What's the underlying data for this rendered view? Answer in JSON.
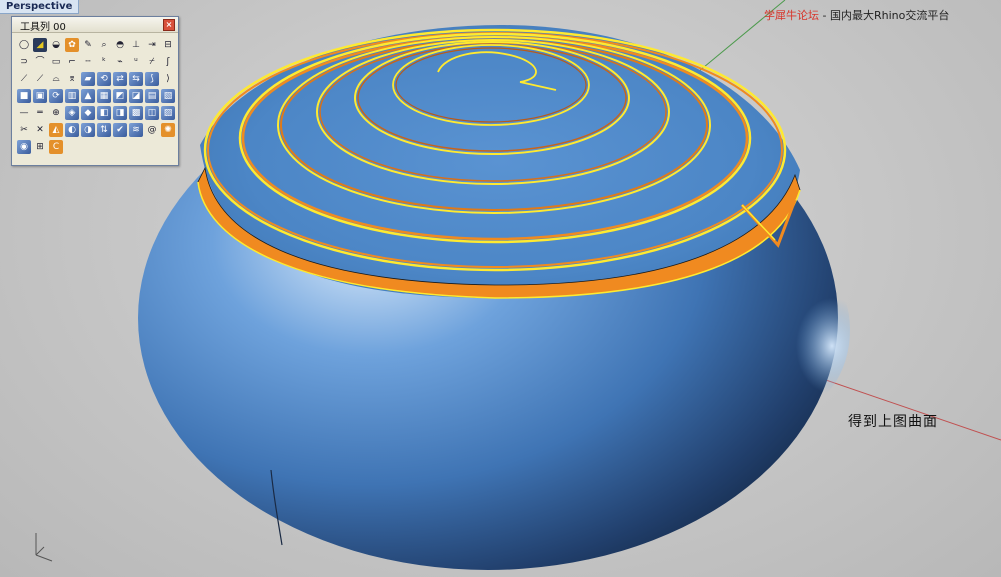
{
  "viewport": {
    "title": "Perspective"
  },
  "toolbar": {
    "title": "工具列 00",
    "close_label": "×",
    "tools": [
      {
        "name": "circle-tool",
        "glyph": "◯",
        "style": "light"
      },
      {
        "name": "shade-tool",
        "glyph": "◢",
        "style": "dark"
      },
      {
        "name": "shield-tool",
        "glyph": "◒",
        "style": "light"
      },
      {
        "name": "gear-tool",
        "glyph": "✿",
        "style": "orange"
      },
      {
        "name": "pencil-tool",
        "glyph": "✎",
        "style": "light"
      },
      {
        "name": "magnify-tool",
        "glyph": "⌕",
        "style": "light"
      },
      {
        "name": "dish-tool",
        "glyph": "◓",
        "style": "light"
      },
      {
        "name": "axis-tool",
        "glyph": "⊥",
        "style": "light"
      },
      {
        "name": "move-tool",
        "glyph": "⇥",
        "style": "light"
      },
      {
        "name": "dim-tool",
        "glyph": "⊟",
        "style": "light"
      },
      {
        "name": "loop-tool",
        "glyph": "⊃",
        "style": "light"
      },
      {
        "name": "arc-tool",
        "glyph": "⌒",
        "style": "light"
      },
      {
        "name": "frame-tool",
        "glyph": "▭",
        "style": "light"
      },
      {
        "name": "crop-tool",
        "glyph": "⌐",
        "style": "light"
      },
      {
        "name": "dash-tool",
        "glyph": "╌",
        "style": "light"
      },
      {
        "name": "label-tool",
        "glyph": "ᵏ",
        "style": "light"
      },
      {
        "name": "tag-tool",
        "glyph": "⌁",
        "style": "light"
      },
      {
        "name": "text-tool",
        "glyph": "ᵘ",
        "style": "light"
      },
      {
        "name": "cut-tool",
        "glyph": "⌿",
        "style": "light"
      },
      {
        "name": "hook-tool",
        "glyph": "ʃ",
        "style": "light"
      },
      {
        "name": "slash-tool",
        "glyph": "⟋",
        "style": "light"
      },
      {
        "name": "angle-tool",
        "glyph": "⟋",
        "style": "light"
      },
      {
        "name": "bridge-tool",
        "glyph": "⌓",
        "style": "light"
      },
      {
        "name": "fold-tool",
        "glyph": "⌆",
        "style": "light"
      },
      {
        "name": "surf-tool",
        "glyph": "▰",
        "style": "filled"
      },
      {
        "name": "twist-tool",
        "glyph": "⟲",
        "style": "filled"
      },
      {
        "name": "swap-tool",
        "glyph": "⇄",
        "style": "filled"
      },
      {
        "name": "extrude-tool",
        "glyph": "⇆",
        "style": "filled"
      },
      {
        "name": "split-tool",
        "glyph": "⟆",
        "style": "filled"
      },
      {
        "name": "end-tool",
        "glyph": "⟩",
        "style": "light"
      },
      {
        "name": "box-tool",
        "glyph": "■",
        "style": "filled"
      },
      {
        "name": "cube-tool",
        "glyph": "▣",
        "style": "filled"
      },
      {
        "name": "rotate-tool",
        "glyph": "⟳",
        "style": "filled"
      },
      {
        "name": "cyl-tool",
        "glyph": "▥",
        "style": "filled"
      },
      {
        "name": "cone-tool",
        "glyph": "▲",
        "style": "filled"
      },
      {
        "name": "plane-tool",
        "glyph": "▦",
        "style": "filled"
      },
      {
        "name": "blend-tool",
        "glyph": "◩",
        "style": "filled"
      },
      {
        "name": "fillet-tool",
        "glyph": "◪",
        "style": "filled"
      },
      {
        "name": "shell-tool",
        "glyph": "▤",
        "style": "filled"
      },
      {
        "name": "cap-tool",
        "glyph": "▧",
        "style": "filled"
      },
      {
        "name": "line-tool",
        "glyph": "—",
        "style": "light"
      },
      {
        "name": "offset-tool",
        "glyph": "═",
        "style": "light"
      },
      {
        "name": "target-tool",
        "glyph": "⊕",
        "style": "light"
      },
      {
        "name": "sweep-tool",
        "glyph": "◈",
        "style": "filled"
      },
      {
        "name": "loft-tool",
        "glyph": "◆",
        "style": "filled"
      },
      {
        "name": "rail-tool",
        "glyph": "◧",
        "style": "filled"
      },
      {
        "name": "sect-tool",
        "glyph": "◨",
        "style": "filled"
      },
      {
        "name": "net-tool",
        "glyph": "▩",
        "style": "filled"
      },
      {
        "name": "patch-tool",
        "glyph": "◫",
        "style": "filled"
      },
      {
        "name": "edge-tool",
        "glyph": "▨",
        "style": "filled"
      },
      {
        "name": "trim-tool",
        "glyph": "✂",
        "style": "light"
      },
      {
        "name": "join-tool",
        "glyph": "✕",
        "style": "light"
      },
      {
        "name": "mirror-tool",
        "glyph": "◭",
        "style": "orange"
      },
      {
        "name": "flow-tool",
        "glyph": "◐",
        "style": "filled"
      },
      {
        "name": "match-tool",
        "glyph": "◑",
        "style": "filled"
      },
      {
        "name": "flip-tool",
        "glyph": "⇅",
        "style": "filled"
      },
      {
        "name": "check-tool",
        "glyph": "✔",
        "style": "filled"
      },
      {
        "name": "zebra-tool",
        "glyph": "≋",
        "style": "filled"
      },
      {
        "name": "spiral-tool",
        "glyph": "@",
        "style": "light"
      },
      {
        "name": "paint-tool",
        "glyph": "✺",
        "style": "orange"
      },
      {
        "name": "render-tool",
        "glyph": "◉",
        "style": "filled"
      },
      {
        "name": "view-tool",
        "glyph": "⊞",
        "style": "light"
      },
      {
        "name": "snap-tool",
        "glyph": "C",
        "style": "orange"
      }
    ]
  },
  "annotation": "得到上图曲面",
  "watermark": {
    "brand": "学犀牛论坛",
    "separator": " - ",
    "tagline": "国内最大Rhino交流平台"
  },
  "colors": {
    "surface_blue": "#4a86c8",
    "groove_orange": "#f08a20",
    "edge_yellow": "#ffea30",
    "axis_green": "#4c9a4c",
    "axis_red": "#c05050"
  }
}
